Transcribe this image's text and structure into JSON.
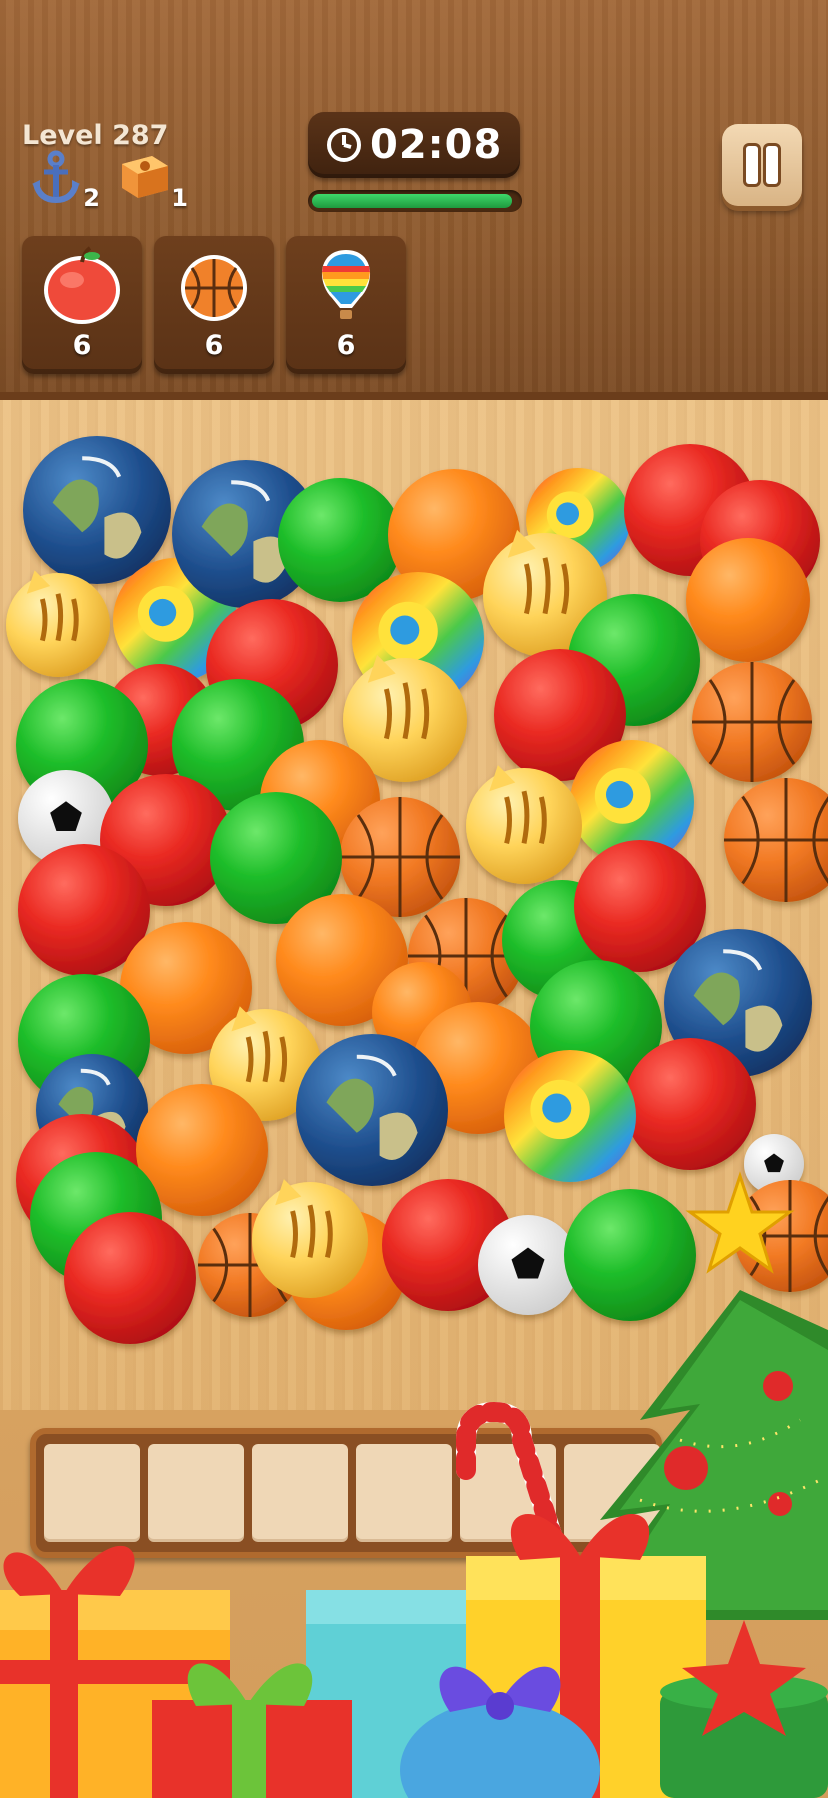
{
  "header": {
    "level_label": "Level 287",
    "timer": "02:08",
    "timer_progress": 0.97
  },
  "boosters": [
    {
      "icon": "anchor-icon",
      "count": "2"
    },
    {
      "icon": "magnet-icon",
      "count": "1"
    }
  ],
  "goals": [
    {
      "icon": "apple-icon",
      "count": "6"
    },
    {
      "icon": "basketball-icon",
      "count": "6"
    },
    {
      "icon": "hot-air-balloon-icon",
      "count": "6"
    }
  ],
  "tray": {
    "slots": 7,
    "filled": 0
  },
  "colors": {
    "red": "#e31b1b",
    "green": "#1fbf2a",
    "orange": "#ff8a1c",
    "timer_fill": "#2fc24f",
    "header_wood": "#8e5a2e"
  },
  "pieces": [
    "earth",
    "green-ball",
    "red-ball",
    "orange-ball",
    "basketball",
    "soccer-ball",
    "cat",
    "rainbow-top",
    "hot-air-balloon"
  ]
}
